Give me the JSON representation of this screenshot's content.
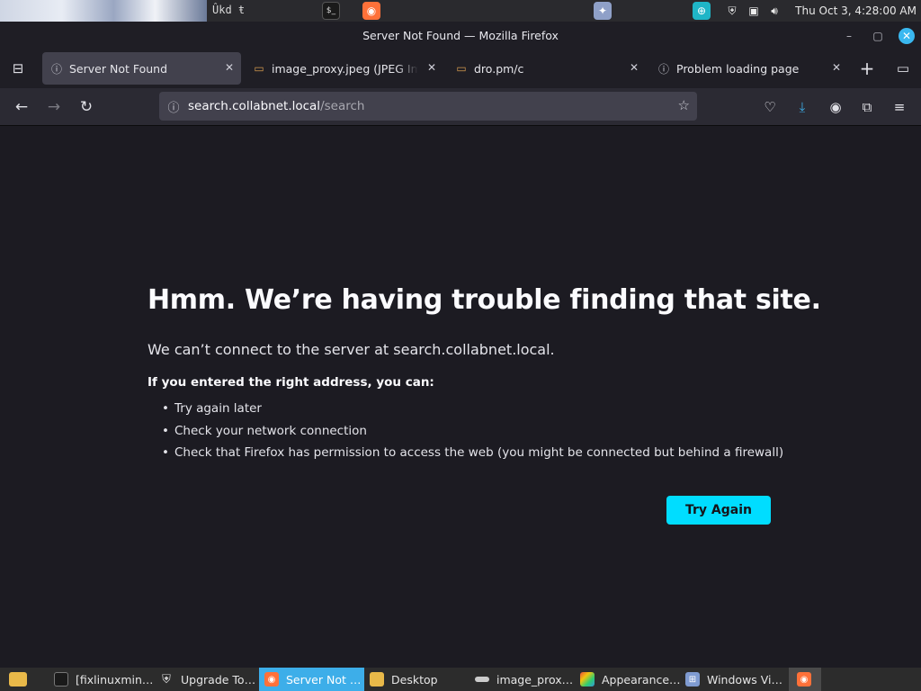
{
  "top_panel": {
    "clock": "Thu Oct  3,  4:28:00 AM",
    "overlay_text": "Ûkd ŧ",
    "colors": {
      "firefox": "#ff7139",
      "terminal": "#1a1a1a",
      "teal_app": "#1fb5c7"
    }
  },
  "window": {
    "title": "Server Not Found — Mozilla Firefox",
    "minimize_icon": "minimize-icon",
    "maximize_icon": "maximize-icon",
    "close_icon": "close-icon"
  },
  "tabs": [
    {
      "label": "Server Not Found",
      "icon": "info-icon",
      "active": true
    },
    {
      "label": "image_proxy.jpeg (JPEG Ima",
      "icon": "image-icon",
      "active": false
    },
    {
      "label": "dro.pm/c",
      "icon": "image-icon",
      "active": false
    },
    {
      "label": "Problem loading page",
      "icon": "info-icon",
      "active": false
    }
  ],
  "navbar": {
    "url_host": "search.collabnet.local",
    "url_path": "/search"
  },
  "error_page": {
    "title": "Hmm. We’re having trouble finding that site.",
    "description": "We can’t connect to the server at search.collabnet.local.",
    "subheading": "If you entered the right address, you can:",
    "suggestions": [
      "Try again later",
      "Check your network connection",
      "Check that Firefox has permission to access the web (you might be connected but behind a firewall)"
    ],
    "button_label": "Try Again",
    "accent": "#00ddff"
  },
  "taskbar": {
    "items": [
      {
        "label": "[fixlinuxmin…",
        "icon": "terminal-icon"
      },
      {
        "label": "Upgrade To…",
        "icon": "shield-icon"
      },
      {
        "label": "Server Not …",
        "icon": "firefox-icon",
        "active": true
      },
      {
        "label": "Desktop",
        "icon": "folder-icon"
      },
      {
        "label": "image_prox…",
        "icon": "image-viewer-icon"
      },
      {
        "label": "Appearance…",
        "icon": "appearance-icon"
      },
      {
        "label": "Windows Vi…",
        "icon": "windows-icon"
      }
    ],
    "active_color": "#3daee9"
  }
}
